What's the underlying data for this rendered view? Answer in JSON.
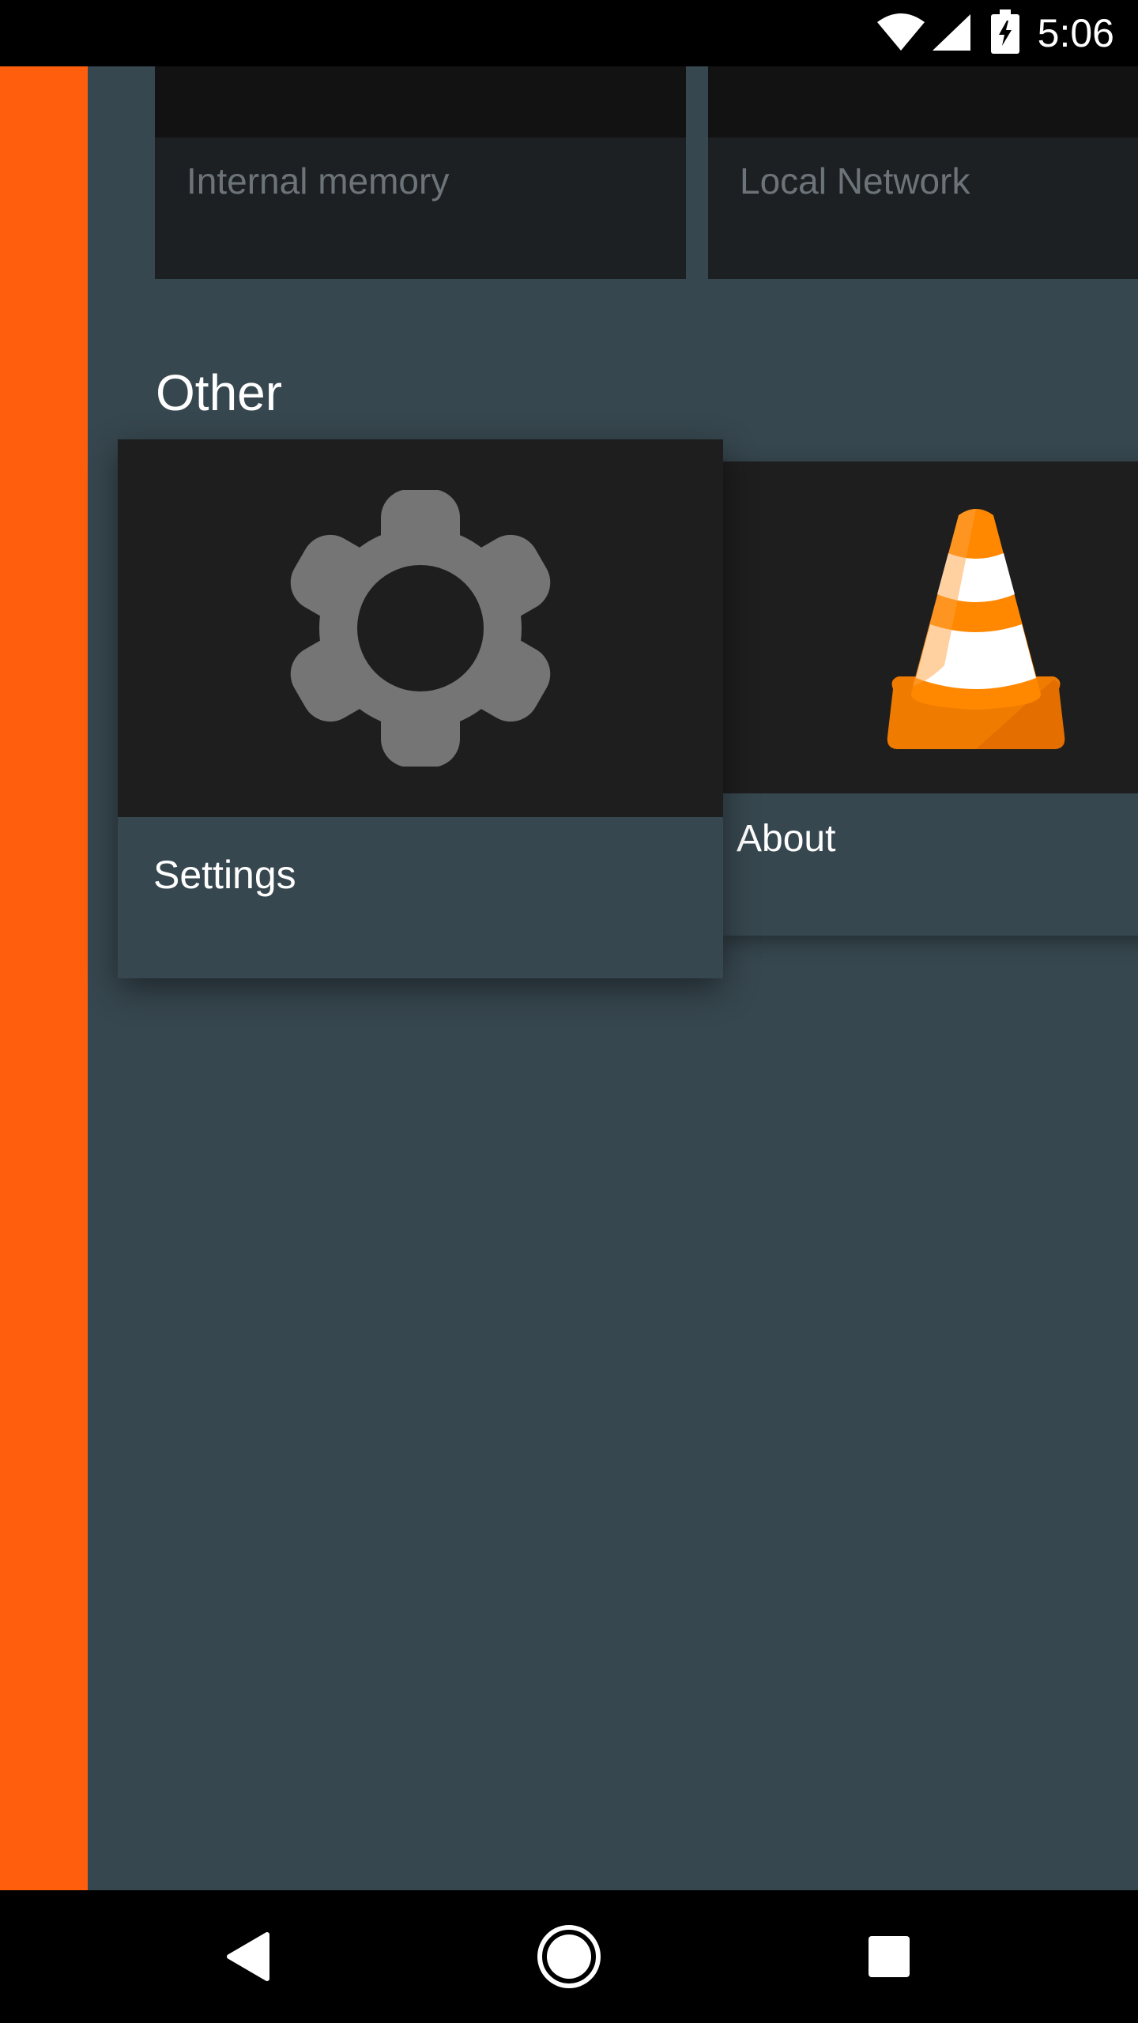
{
  "status_bar": {
    "time": "5:06",
    "icons": [
      "wifi-icon",
      "signal-icon",
      "battery-charging-icon"
    ]
  },
  "storage": {
    "cards": [
      {
        "label": "Internal memory"
      },
      {
        "label": "Local Network"
      }
    ]
  },
  "other": {
    "title": "Other",
    "cards": [
      {
        "label": "Settings",
        "icon": "gear-icon"
      },
      {
        "label": "About",
        "icon": "vlc-cone-icon"
      }
    ]
  },
  "nav_bar": {
    "buttons": [
      "back-icon",
      "home-icon",
      "recents-icon"
    ]
  },
  "colors": {
    "accent": "#ff5f0d",
    "background": "#37474f",
    "card_dark": "#1e1e1e"
  }
}
